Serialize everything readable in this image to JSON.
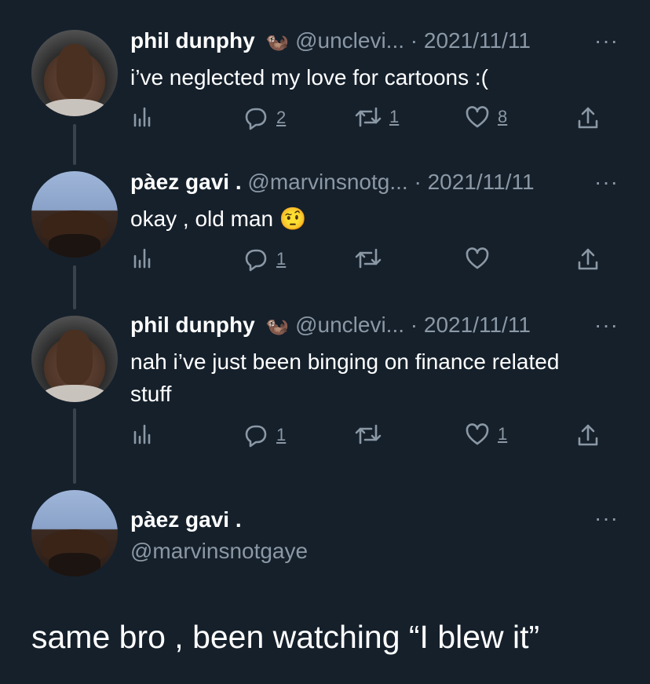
{
  "tweets": [
    {
      "name": "phil dunphy",
      "emoji": "🦦",
      "handle": "@unclevi...",
      "sep": "·",
      "date": "2021/11/11",
      "text": "i’ve neglected my love for cartoons :(",
      "replies": "2",
      "retweets": "1",
      "likes": "8"
    },
    {
      "name": "pàez gavi .",
      "emoji": "",
      "handle": "@marvinsnotg...",
      "sep": "·",
      "date": "2021/11/11",
      "text": "okay , old man 🤨",
      "replies": "1",
      "retweets": "",
      "likes": ""
    },
    {
      "name": "phil dunphy",
      "emoji": "🦦",
      "handle": "@unclevi...",
      "sep": "·",
      "date": "2021/11/11",
      "text": "nah i’ve just been binging on finance related stuff",
      "replies": "1",
      "retweets": "",
      "likes": "1"
    }
  ],
  "main_tweet": {
    "name": "pàez gavi .",
    "handle": "@marvinsnotgaye",
    "text": "same bro , been watching “I blew it”"
  },
  "more_glyph": "···",
  "icons": {
    "analytics": "analytics-icon",
    "reply": "reply-icon",
    "retweet": "retweet-icon",
    "like": "heart-icon",
    "share": "share-icon"
  },
  "colors": {
    "background": "#15202b",
    "text": "#ffffff",
    "muted": "#8b98a5",
    "thread_line": "#38444d"
  }
}
